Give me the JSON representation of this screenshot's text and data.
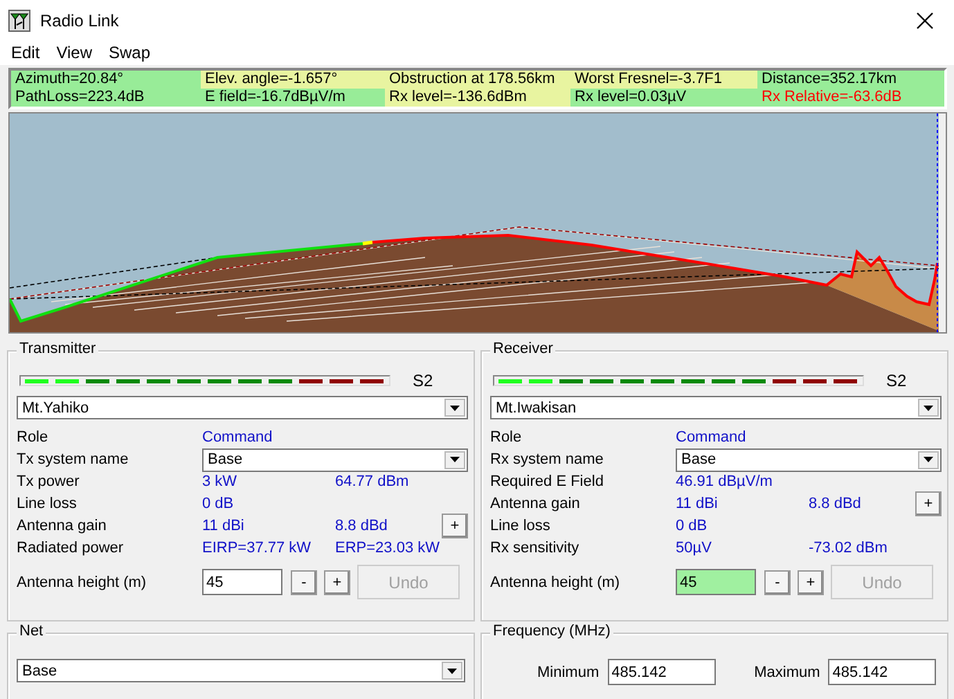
{
  "window": {
    "title": "Radio Link"
  },
  "menu": [
    {
      "label": "Edit"
    },
    {
      "label": "View"
    },
    {
      "label": "Swap"
    }
  ],
  "info": [
    [
      {
        "text": "Azimuth=20.84°",
        "color": "#98ec98",
        "alert": false
      },
      {
        "text": "Elev. angle=-1.657°",
        "color": "#e8f4a0",
        "alert": false
      },
      {
        "text": "Obstruction at 178.56km",
        "color": "#e8f4a0",
        "alert": false
      },
      {
        "text": "Worst Fresnel=-3.7F1",
        "color": "#e8f4a0",
        "alert": false
      },
      {
        "text": "Distance=352.17km",
        "color": "#98ec98",
        "alert": false
      }
    ],
    [
      {
        "text": "PathLoss=223.4dB",
        "color": "#98ec98",
        "alert": false
      },
      {
        "text": "E field=-16.7dBµV/m",
        "color": "#98ec98",
        "alert": false
      },
      {
        "text": "Rx level=-136.6dBm",
        "color": "#e8f4a0",
        "alert": false
      },
      {
        "text": "Rx level=0.03µV",
        "color": "#98ec98",
        "alert": false
      },
      {
        "text": "Rx Relative=-63.6dB",
        "color": "#98ec98",
        "alert": true
      }
    ]
  ],
  "transmitter": {
    "title": "Transmitter",
    "meter": {
      "level": 0.1667,
      "reading": "S2"
    },
    "site": "Mt.Yahiko",
    "rows": [
      {
        "kind": "text",
        "label": "Role",
        "value": "Command"
      },
      {
        "kind": "combo",
        "label": "Tx system name",
        "value": "Base"
      },
      {
        "kind": "text",
        "label": "Tx power",
        "value": "3 kW",
        "value2": "64.77 dBm"
      },
      {
        "kind": "text",
        "label": "Line loss",
        "value": "0 dB"
      },
      {
        "kind": "text",
        "label": "Antenna gain",
        "value": "11 dBi",
        "value2": "8.8 dBd",
        "button": "+"
      },
      {
        "kind": "text",
        "label": "Radiated power",
        "value": "EIRP=37.77 kW",
        "value2": "ERP=23.03 kW"
      }
    ],
    "height": {
      "label": "Antenna height (m)",
      "value": "45",
      "highlighted": false,
      "minus": "-",
      "plus": "+",
      "undo": "Undo",
      "undo_disabled": true
    }
  },
  "receiver": {
    "title": "Receiver",
    "meter": {
      "level": 0.1667,
      "reading": "S2"
    },
    "site": "Mt.Iwakisan",
    "rows": [
      {
        "kind": "text",
        "label": "Role",
        "value": "Command"
      },
      {
        "kind": "combo",
        "label": "Rx system name",
        "value": "Base"
      },
      {
        "kind": "text",
        "label": "Required E Field",
        "value": "46.91 dBµV/m"
      },
      {
        "kind": "text",
        "label": "Antenna gain",
        "value": "11 dBi",
        "value2": "8.8 dBd",
        "button": "+"
      },
      {
        "kind": "text",
        "label": "Line loss",
        "value": "0 dB"
      },
      {
        "kind": "text",
        "label": "Rx sensitivity",
        "value": "50µV",
        "value2": "-73.02 dBm"
      }
    ],
    "height": {
      "label": "Antenna height (m)",
      "value": "45",
      "highlighted": true,
      "minus": "-",
      "plus": "+",
      "undo": "Undo",
      "undo_disabled": true
    }
  },
  "net": {
    "title": "Net",
    "value": "Base"
  },
  "frequency": {
    "title": "Frequency (MHz)",
    "minimum": {
      "label": "Minimum",
      "value": "485.142"
    },
    "maximum": {
      "label": "Maximum",
      "value": "485.142"
    }
  }
}
